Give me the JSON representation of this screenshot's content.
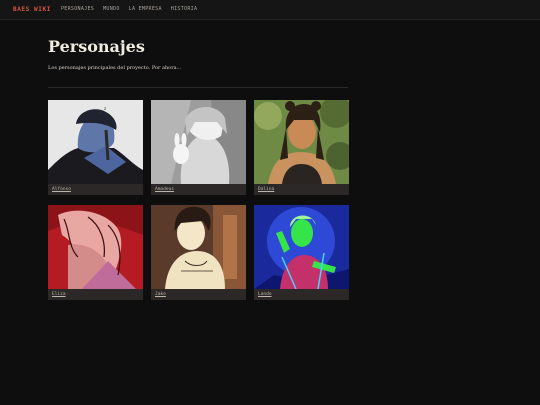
{
  "header": {
    "brand": "BAES WIKI",
    "nav": [
      "PERSONAJES",
      "MUNDO",
      "LA EMPRESA",
      "HISTORIA"
    ]
  },
  "page": {
    "title": "Personajes",
    "subtitle": "Los personajes principales del proyecto. Por ahora..."
  },
  "characters": [
    {
      "name": "Alfonso"
    },
    {
      "name": "Amadeus"
    },
    {
      "name": "Dalina"
    },
    {
      "name": "Eliza"
    },
    {
      "name": "Jake"
    },
    {
      "name": "Lando"
    }
  ],
  "colors": {
    "background": "#0f0e0e",
    "brand": "#d8553f",
    "card": "#2b2827"
  }
}
